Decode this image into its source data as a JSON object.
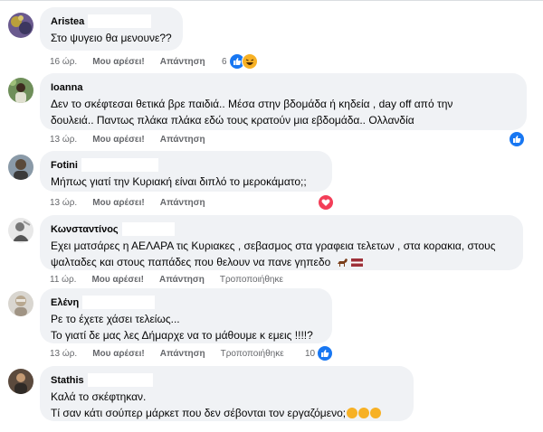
{
  "actions": {
    "like": "Μου αρέσει!",
    "reply": "Απάντηση",
    "edit": "Τροποποιήθηκε"
  },
  "comments": [
    {
      "author": "Aristea",
      "lines": [
        "Στο ψυγειο θα μενουνε??"
      ],
      "time": "16 ώρ.",
      "reaction_count": "6",
      "reactions": [
        "like-icon",
        "haha-icon"
      ]
    },
    {
      "author": "Ioanna",
      "lines": [
        "Δεν το σκέφτεσαι θετικά βρε παιδιά.. Μέσα στην βδομάδα ή κηδεία , day off από την",
        "δουλειά.. Παντως πλάκα πλάκα εδώ τους κρατούν μια εβδομάδα.. Ολλανδία"
      ],
      "time": "13 ώρ.",
      "reaction_count": "",
      "reactions": [
        "like-icon"
      ]
    },
    {
      "author": "Fotini",
      "lines": [
        "Μήπως γιατί την Κυριακή είναι διπλό το μεροκάματο;;"
      ],
      "time": "13 ώρ.",
      "reaction_count": "",
      "reactions": [
        "heart-icon"
      ]
    },
    {
      "author": "Κωνσταντίνος",
      "lines": [
        "Εχει ματσάρες η ΑΕΛΑΡΑ τις Κυριακες , σεβασμος στα γραφεια τελετων , στα κορακια, στους",
        "ψαλταδες και στους παπάδες που θελουν να πανε γηπεδο"
      ],
      "time": "11 ώρ.",
      "edited": true,
      "reaction_count": "",
      "reactions": []
    },
    {
      "author": "Ελένη",
      "lines": [
        "Ρε το έχετε χάσει τελείως...",
        "Το γιατί δε μας λες Δήμαρχε να το μάθουμε κ εμεις !!!!?"
      ],
      "time": "13 ώρ.",
      "edited": true,
      "reaction_count": "10",
      "reactions": [
        "like-icon"
      ]
    },
    {
      "author": "Stathis",
      "lines": [
        "Καλά το σκέφτηκαν.",
        "Τί σαν κάτι σούπερ μάρκετ που δεν σέβονται τον εργαζόμενο;"
      ],
      "time": "16 ώρ.",
      "reaction_count": "",
      "reactions": []
    }
  ],
  "colors": {
    "bubble": "#f0f2f5",
    "like": "#1877f2",
    "heart": "#f33e58",
    "haha": "#f7b125",
    "meta": "#65676b"
  }
}
